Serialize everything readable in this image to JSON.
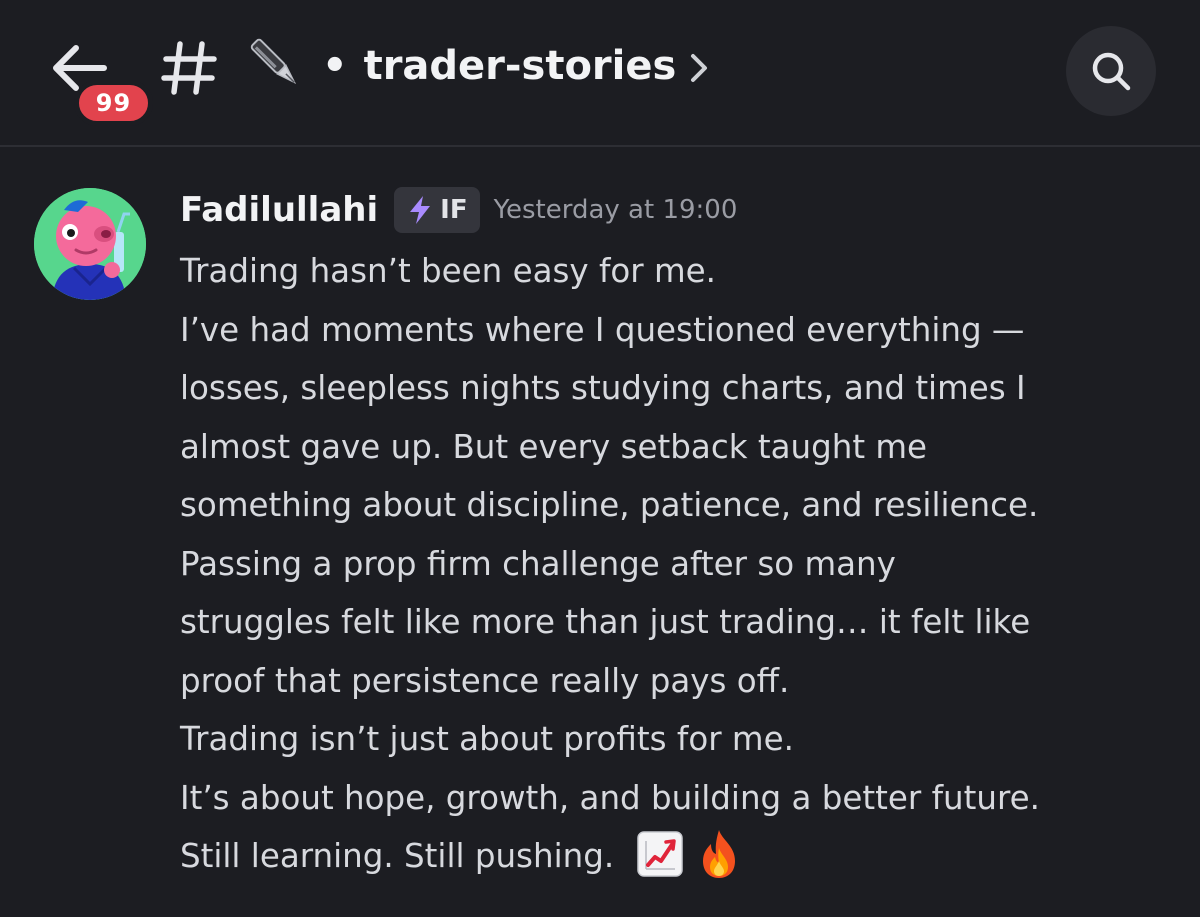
{
  "header": {
    "back_icon": "arrow-left-icon",
    "unread_count": "99",
    "channel_icon": "hash-icon",
    "channel_emoji": "pen-icon",
    "channel_separator": "•",
    "channel_name": "trader-stories",
    "chevron_icon": "chevron-right-icon",
    "search_icon": "search-icon"
  },
  "message": {
    "author": "Fadilullahi",
    "role_tag": {
      "icon": "lightning-bolt-icon",
      "label": "IF"
    },
    "timestamp": "Yesterday at 19:00",
    "lines": [
      "Trading hasn’t been easy for me.",
      "I’ve had moments where I questioned everything —",
      "losses, sleepless nights studying charts, and times I",
      "almost gave up. But every setback taught me",
      "something about discipline, patience, and resilience.",
      "Passing a prop firm challenge after so many",
      "struggles felt like more than just trading… it felt like",
      "proof that persistence really pays off.",
      "Trading isn’t just about profits for me.",
      "It’s about hope, growth, and building a better future.",
      "Still learning. Still pushing."
    ],
    "trailing_emojis": [
      "chart-increasing-icon",
      "fire-icon"
    ]
  },
  "colors": {
    "background": "#1c1d22",
    "text_primary": "#f2f3f5",
    "text_body": "#d7d9de",
    "text_muted": "#9a9ca4",
    "badge": "#e2434d",
    "role_tag_bg": "#34353c",
    "bolt": "#a98bff",
    "avatar_bg": "#57d68d"
  }
}
